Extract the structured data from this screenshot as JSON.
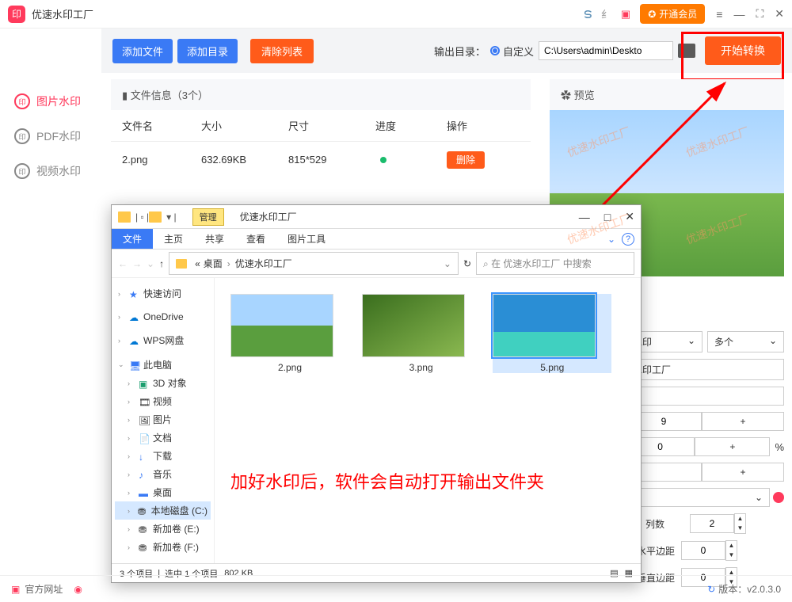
{
  "app": {
    "title": "优速水印工厂"
  },
  "titlebar": {
    "vip_label": "开通会员"
  },
  "toolbar": {
    "add_file": "添加文件",
    "add_dir": "添加目录",
    "clear": "清除列表",
    "output_label": "输出目录：",
    "output_mode": "自定义",
    "output_path": "C:\\Users\\admin\\Deskto",
    "start": "开始转换"
  },
  "sidebar": {
    "items": [
      {
        "label": "图片水印"
      },
      {
        "label": "PDF水印"
      },
      {
        "label": "视频水印"
      }
    ]
  },
  "file_panel": {
    "heading": "文件信息（3个）",
    "cols": {
      "name": "文件名",
      "size": "大小",
      "dim": "尺寸",
      "prog": "进度",
      "act": "操作"
    },
    "rows": [
      {
        "name": "2.png",
        "size": "632.69KB",
        "dim": "815*529",
        "action": "删除"
      }
    ]
  },
  "preview": {
    "heading": "预览",
    "watermark": "优速水印工厂"
  },
  "settings": {
    "column1": "水印",
    "column2": "多个",
    "text_value": "水印工厂",
    "row_val": "9",
    "pct_val": "0",
    "pct_unit": "%",
    "cols_label": "列数",
    "cols_val": "2",
    "hmargin": "水平边距",
    "hmargin_val": "0",
    "vmargin": "垂直边距",
    "vmargin_val": "0"
  },
  "explorer": {
    "title": "优速水印工厂",
    "manage_tab": "管理",
    "ribbon": {
      "file": "文件",
      "home": "主页",
      "share": "共享",
      "view": "查看",
      "pic_tools": "图片工具"
    },
    "path_crumbs": [
      "桌面",
      "优速水印工厂"
    ],
    "search_placeholder": "在 优速水印工厂 中搜索",
    "tree": [
      "快速访问",
      "OneDrive",
      "WPS网盘",
      "此电脑",
      "3D 对象",
      "视频",
      "图片",
      "文档",
      "下载",
      "音乐",
      "桌面",
      "本地磁盘 (C:)",
      "新加卷 (E:)",
      "新加卷 (F:)"
    ],
    "files": [
      {
        "name": "2.png"
      },
      {
        "name": "3.png"
      },
      {
        "name": "5.png"
      }
    ],
    "status": {
      "items": "3 个项目",
      "selected": "选中 1 个项目",
      "size": "802 KB"
    },
    "note": "加好水印后，软件会自动打开输出文件夹"
  },
  "footer": {
    "site": "官方网址",
    "version_label": "版本：",
    "version": "v2.0.3.0"
  }
}
